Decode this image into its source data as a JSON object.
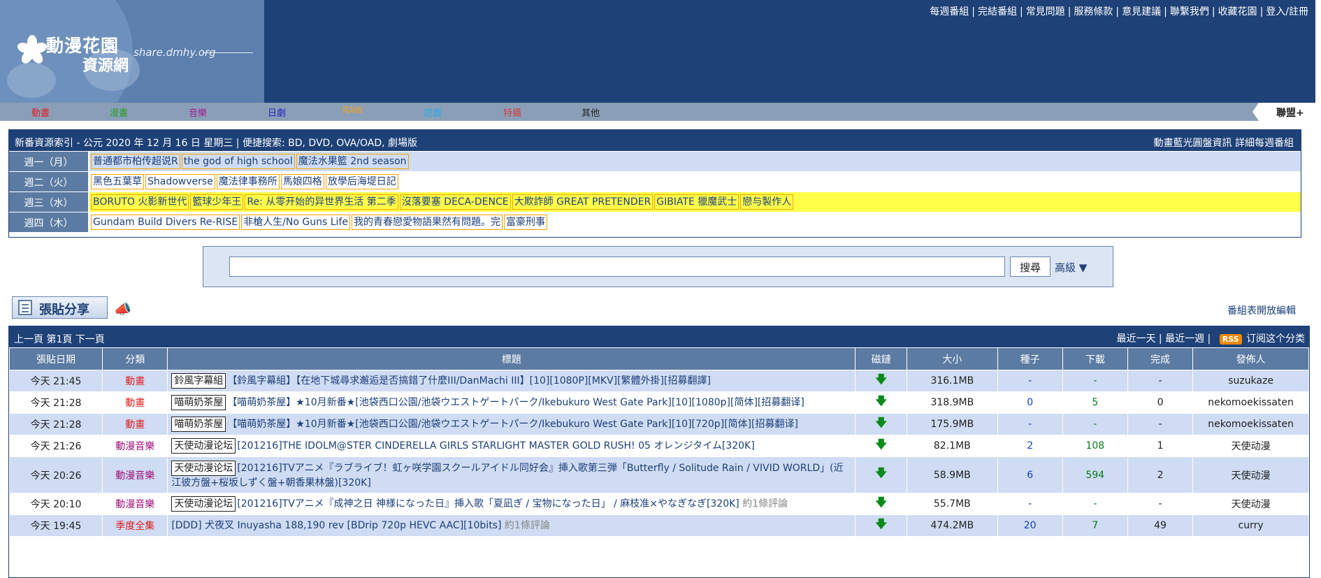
{
  "header": {
    "logo_title": "動漫花園",
    "logo_subtitle": "資源網",
    "logo_url": "share.dmhy.org",
    "toplinks": [
      "每週番組",
      "完結番組",
      "常見問題",
      "服務條款",
      "意見建議",
      "聯繫我們",
      "收藏花園",
      "登入/註冊"
    ]
  },
  "catnav": {
    "items": [
      {
        "label": "動畫",
        "color": "#e02020"
      },
      {
        "label": "漫畫",
        "color": "#2a9a2a"
      },
      {
        "label": "音樂",
        "color": "#a02090"
      },
      {
        "label": "日劇",
        "color": "#2020c0"
      },
      {
        "label": "RAW",
        "color": "#f0a020"
      },
      {
        "label": "遊戲",
        "color": "#30a8e0"
      },
      {
        "label": "特攝",
        "color": "#d04040"
      },
      {
        "label": "其他",
        "color": "#222222"
      }
    ],
    "union": "聯盟+"
  },
  "weekly": {
    "title": "新番資源索引 - 公元 2020 年 12 月 16 日 星期三 | 便捷搜索: BD, DVD, OVA/OAD, 劇場版",
    "right": "動畫藍光圓盤資訊 詳細每週番組",
    "rows": [
      {
        "day": "週一（月）",
        "bg": "#cfdcf3",
        "items": [
          "普通都市柏传超说R",
          "the god of high school",
          "魔法水果籃 2nd season"
        ]
      },
      {
        "day": "週二（火）",
        "bg": "#ffffff",
        "items": [
          "黑色五葉草",
          "Shadowverse",
          "魔法律事務所",
          "馬娘四格",
          "放學后海堤日記"
        ]
      },
      {
        "day": "週三（水）",
        "bg": "#ffff4a",
        "items": [
          "BORUTO 火影新世代",
          "籃球少年王",
          "Re: 从零开始的异世界生活 第二季",
          "沒落要塞 DECA-DENCE",
          "大欺詐師 GREAT PRETENDER",
          "GIBIATE 獵魔武士",
          "戀与製作人"
        ]
      },
      {
        "day": "週四（木）",
        "bg": "#ffffff",
        "items": [
          "Gundam Build Divers Re-RISE",
          "非槍人生/No Guns Life",
          "我的青春戀愛物語果然有問題。完",
          "富豪刑事"
        ]
      }
    ]
  },
  "search": {
    "placeholder": "",
    "button": "搜尋",
    "advanced": "高級 ▼"
  },
  "post_button": "張貼分享",
  "open_edit": "番組表開放編輯",
  "listing": {
    "nav": "上一頁 第1頁 下一頁",
    "right_links": [
      "最近一天",
      "最近一週"
    ],
    "rss": "RSS",
    "rss_text": "订阅这个分类",
    "columns": [
      "張貼日期",
      "分類",
      "標題",
      "磁鏈",
      "大小",
      "種子",
      "下載",
      "完成",
      "發佈人"
    ],
    "rows": [
      {
        "date": "今天 21:45",
        "cat": "動畫",
        "cat_color": "#e02020",
        "tag": "鈴風字幕組",
        "title": "【鈴風字幕組】【在地下城尋求邂逅是否搞錯了什麼III/DanMachi III】[10][1080P][MKV][繁體外掛][招募翻譯]",
        "comment": "",
        "size": "316.1MB",
        "seeds": "-",
        "downloads": "-",
        "done": "-",
        "user": "suzukaze"
      },
      {
        "date": "今天 21:28",
        "cat": "動畫",
        "cat_color": "#e02020",
        "tag": "喵萌奶茶屋",
        "title": "【喵萌奶茶屋】★10月新番★[池袋西口公園/池袋ウエストゲートパーク/Ikebukuro West Gate Park][10][1080p][简体][招募翻译]",
        "comment": "",
        "size": "318.9MB",
        "seeds": "0",
        "downloads": "5",
        "done": "0",
        "user": "nekomoekissaten"
      },
      {
        "date": "今天 21:28",
        "cat": "動畫",
        "cat_color": "#e02020",
        "tag": "喵萌奶茶屋",
        "title": "【喵萌奶茶屋】★10月新番★[池袋西口公園/池袋ウエストゲートパーク/Ikebukuro West Gate Park][10][720p][简体][招募翻译]",
        "comment": "",
        "size": "175.9MB",
        "seeds": "-",
        "downloads": "-",
        "done": "-",
        "user": "nekomoekissaten"
      },
      {
        "date": "今天 21:26",
        "cat": "動漫音樂",
        "cat_color": "#a0107a",
        "tag": "天使动漫论坛",
        "title": "[201216]THE IDOLM@STER CINDERELLA GIRLS STARLIGHT MASTER GOLD RUSH! 05 オレンジタイム[320K]",
        "comment": "",
        "size": "82.1MB",
        "seeds": "2",
        "downloads": "108",
        "done": "1",
        "user": "天使动漫"
      },
      {
        "date": "今天 20:26",
        "cat": "動漫音樂",
        "cat_color": "#a0107a",
        "tag": "天使动漫论坛",
        "title": "[201216]TVアニメ『ラブライブ！虹ヶ咲学園スクールアイドル同好会』挿入歌第三弾「Butterfly / Solitude Rain / VIVID WORLD」(近江彼方盤+桜坂しずく盤+朝香果林盤)[320K]",
        "comment": "",
        "size": "58.9MB",
        "seeds": "6",
        "downloads": "594",
        "done": "2",
        "user": "天使动漫"
      },
      {
        "date": "今天 20:10",
        "cat": "動漫音樂",
        "cat_color": "#a0107a",
        "tag": "天使动漫论坛",
        "title": "[201216]TVアニメ『成神之日 神様になった日』挿入歌「夏凪ぎ / 宝物になった日」 / 麻枝准×やなぎなぎ[320K]",
        "comment": "約1條評論",
        "size": "55.7MB",
        "seeds": "-",
        "downloads": "-",
        "done": "-",
        "user": "天使动漫"
      },
      {
        "date": "今天 19:45",
        "cat": "季度全集",
        "cat_color": "#e02020",
        "tag": "",
        "title": "[DDD] 犬夜叉 Inuyasha 188,190 rev [BDrip 720p HEVC AAC][10bits]",
        "comment": "約1條評論",
        "size": "474.2MB",
        "seeds": "20",
        "downloads": "7",
        "done": "49",
        "user": "curry"
      }
    ]
  }
}
